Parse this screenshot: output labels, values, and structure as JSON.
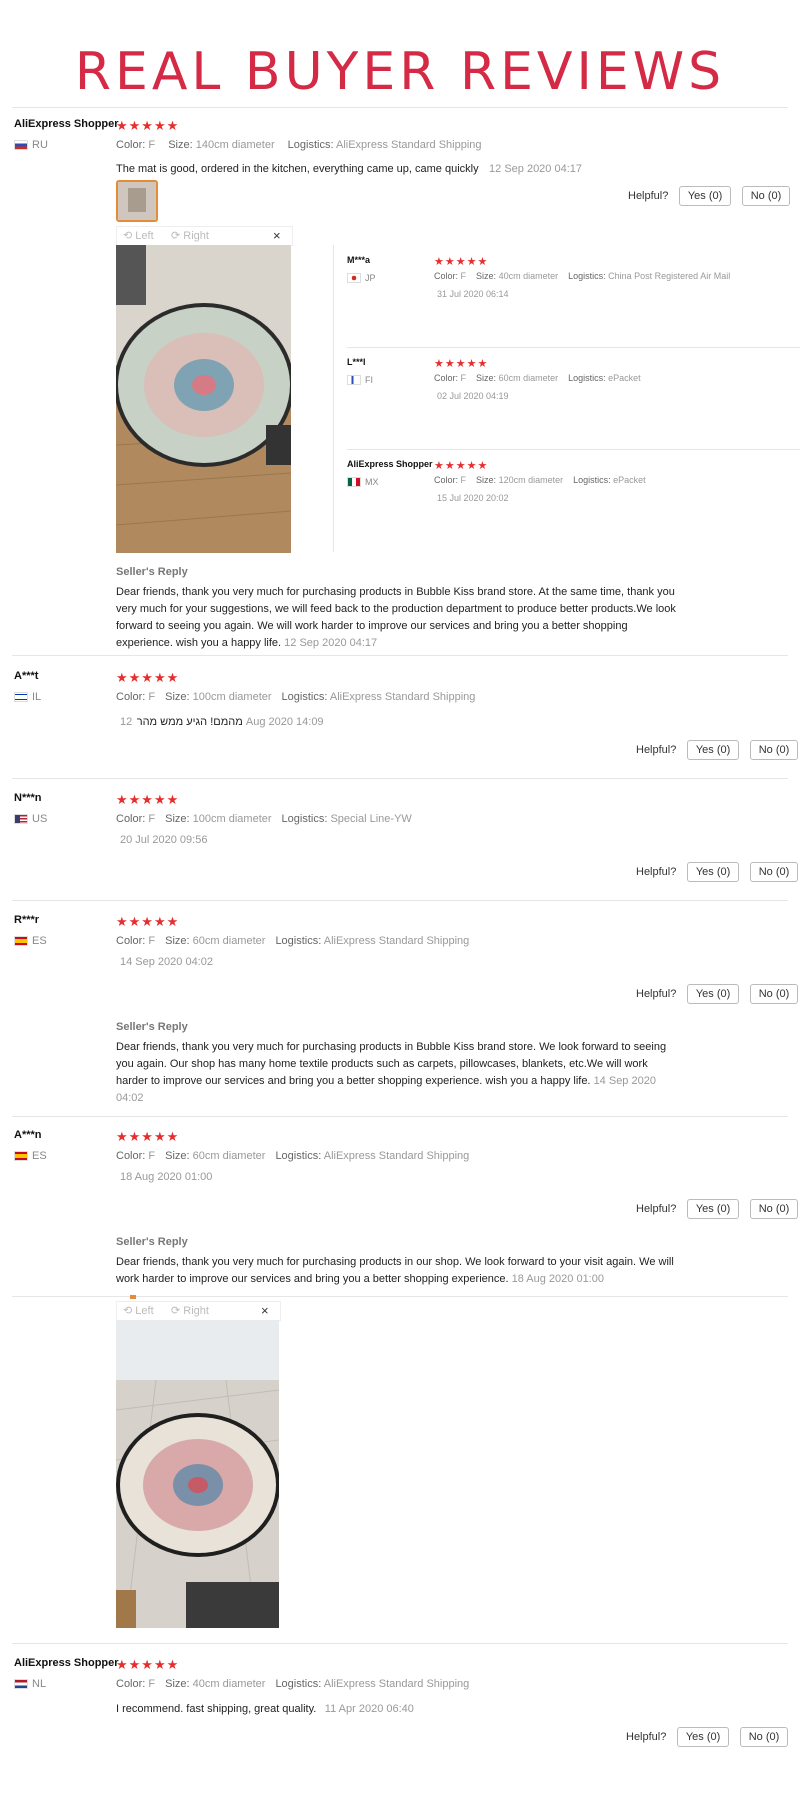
{
  "page_title": "REAL BUYER REVIEWS",
  "labels": {
    "color": "Color:",
    "size": "Size:",
    "logistics": "Logistics:",
    "helpful": "Helpful?",
    "yes": "Yes (0)",
    "no": "No (0)",
    "seller_reply": "Seller's Reply",
    "left": "Left",
    "right": "Right",
    "close": "×"
  },
  "stars": "★★★★★",
  "reviews": [
    {
      "name": "AliExpress Shopper",
      "country": "RU",
      "color": "F",
      "size": "140cm diameter",
      "logistics": "AliExpress Standard Shipping",
      "text": "The mat is good, ordered in the kitchen, everything came up, came quickly",
      "date": "12 Sep 2020 04:17",
      "reply": "Dear friends, thank you very much for purchasing products in Bubble Kiss brand store. At the same time, thank you very much for your suggestions, we will feed back to the production department to produce better products.We look forward to seeing you again. We will work harder to improve our services and bring you a better shopping experience. wish you a happy life.",
      "reply_date": "12 Sep 2020 04:17"
    },
    {
      "name": "A***t",
      "country": "IL",
      "color": "F",
      "size": "100cm diameter",
      "logistics": "AliExpress Standard Shipping",
      "text": "מהמם! הגיע ממש מהר",
      "date": "12 Aug 2020 14:09"
    },
    {
      "name": "N***n",
      "country": "US",
      "color": "F",
      "size": "100cm diameter",
      "logistics": "Special Line-YW",
      "date": "20 Jul 2020 09:56"
    },
    {
      "name": "R***r",
      "country": "ES",
      "color": "F",
      "size": "60cm diameter",
      "logistics": "AliExpress Standard Shipping",
      "date": "14 Sep 2020 04:02",
      "reply": "Dear friends, thank you very much for purchasing products in Bubble Kiss brand store. We look forward to seeing you again. Our shop has many home textile products such as carpets, pillowcases, blankets, etc.We will work harder to improve our services and bring you a better shopping experience. wish you a happy life.",
      "reply_date": "14 Sep 2020 04:02"
    },
    {
      "name": "A***n",
      "country": "ES",
      "color": "F",
      "size": "60cm diameter",
      "logistics": "AliExpress Standard Shipping",
      "date": "18 Aug 2020 01:00",
      "reply": "Dear friends, thank you very much for purchasing products in our shop. We look forward to your visit again. We will work harder to improve our services and bring you a better shopping experience.",
      "reply_date": "18 Aug 2020 01:00"
    },
    {
      "name": "AliExpress Shopper",
      "country": "NL",
      "color": "F",
      "size": "40cm diameter",
      "logistics": "AliExpress Standard Shipping",
      "text": "I recommend. fast shipping, great quality.",
      "date": "11 Apr 2020 06:40"
    }
  ],
  "side_reviews": [
    {
      "name": "M***a",
      "country": "JP",
      "color": "F",
      "size": "40cm diameter",
      "logistics": "China Post Registered Air Mail",
      "date": "31 Jul 2020 06:14"
    },
    {
      "name": "L***l",
      "country": "FI",
      "color": "F",
      "size": "60cm diameter",
      "logistics": "ePacket",
      "date": "02 Jul 2020 04:19"
    },
    {
      "name": "AliExpress Shopper",
      "country": "MX",
      "color": "F",
      "size": "120cm diameter",
      "logistics": "ePacket",
      "date": "15 Jul 2020 20:02"
    }
  ]
}
